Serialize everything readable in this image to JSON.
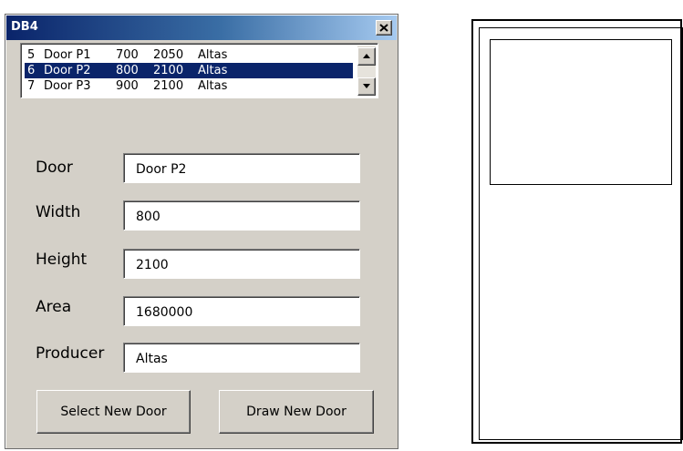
{
  "window": {
    "title": "DB4",
    "close_symbol": "×"
  },
  "door_list": {
    "rows": [
      {
        "id": "5",
        "name": "Door P1",
        "width": "700",
        "height": "2050",
        "producer": "Altas",
        "selected": false
      },
      {
        "id": "6",
        "name": "Door P2",
        "width": "800",
        "height": "2100",
        "producer": "Altas",
        "selected": true
      },
      {
        "id": "7",
        "name": "Door P3",
        "width": "900",
        "height": "2100",
        "producer": "Altas",
        "selected": false
      }
    ]
  },
  "form": {
    "door_label": "Door",
    "door_value": "Door P2",
    "width_label": "Width",
    "width_value": "800",
    "height_label": "Height",
    "height_value": "2100",
    "area_label": "Area",
    "area_value": "1680000",
    "producer_label": "Producer",
    "producer_value": "Altas"
  },
  "buttons": {
    "select_label": "Select New Door",
    "draw_label": "Draw New Door"
  },
  "colors": {
    "dialog_bg": "#d4d0c8",
    "titlebar_start": "#0a246a",
    "titlebar_end": "#a6caf0",
    "selection": "#0a246a"
  },
  "icons": {
    "close": "close-icon",
    "scroll_up": "arrow-up-icon",
    "scroll_down": "arrow-down-icon"
  }
}
